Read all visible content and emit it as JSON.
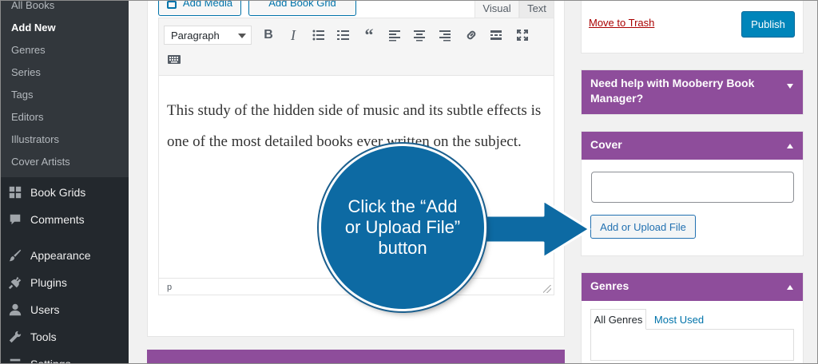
{
  "sidebar": {
    "submenu": [
      "All Books",
      "Add New",
      "Genres",
      "Series",
      "Tags",
      "Editors",
      "Illustrators",
      "Cover Artists"
    ],
    "menu": [
      {
        "label": "Book Grids",
        "icon": "grid-icon"
      },
      {
        "label": "Comments",
        "icon": "comment-icon"
      },
      {
        "label": "Appearance",
        "icon": "paintbrush-icon"
      },
      {
        "label": "Plugins",
        "icon": "plug-icon"
      },
      {
        "label": "Users",
        "icon": "user-icon"
      },
      {
        "label": "Tools",
        "icon": "wrench-icon"
      },
      {
        "label": "Settings",
        "icon": "settings-icon"
      }
    ]
  },
  "editor": {
    "add_media": "Add Media",
    "add_book_grid": "Add Book Grid",
    "tab_visual": "Visual",
    "tab_text": "Text",
    "format": "Paragraph",
    "content": "This study of the hidden side of music and its subtle effects is one of the most detailed books ever written on the subject.",
    "path": "p"
  },
  "publish": {
    "trash": "Move to Trash",
    "publish": "Publish"
  },
  "help_box": {
    "title": "Need help with Mooberry Book Manager?"
  },
  "cover_box": {
    "title": "Cover",
    "upload": "Add or Upload File"
  },
  "genres_box": {
    "title": "Genres",
    "tab_all": "All Genres",
    "tab_most": "Most Used"
  },
  "callout": {
    "text": "Click the “Add or Upload File” button"
  },
  "colors": {
    "accent_purple": "#8e4d9b",
    "sidebar_dark": "#23282d",
    "callout_blue": "#0d6aa3",
    "primary_blue": "#0085ba"
  }
}
